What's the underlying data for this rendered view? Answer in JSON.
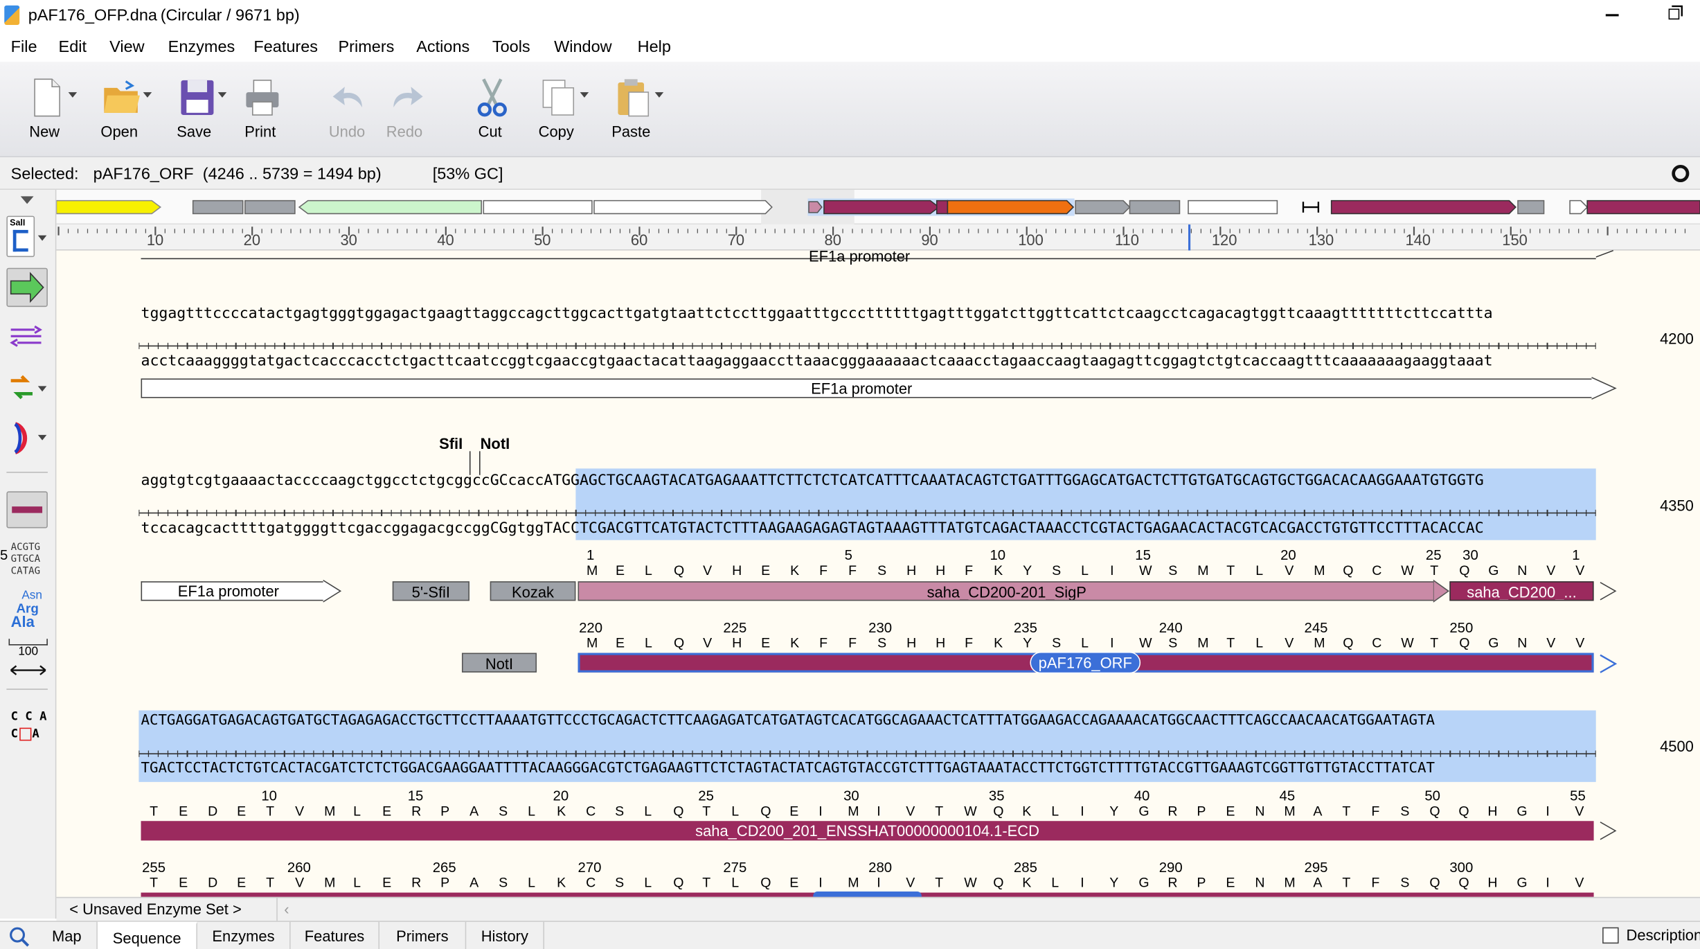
{
  "app": {
    "title": "pAF176_OFP.dna",
    "title_detail": "(Circular / 9671 bp)"
  },
  "menu": [
    "File",
    "Edit",
    "View",
    "Enzymes",
    "Features",
    "Primers",
    "Actions",
    "Tools",
    "Window",
    "Help"
  ],
  "toolbar": {
    "new": "New",
    "open": "Open",
    "save": "Save",
    "print": "Print",
    "undo": "Undo",
    "redo": "Redo",
    "cut": "Cut",
    "copy": "Copy",
    "paste": "Paste"
  },
  "selection": {
    "label": "Selected:",
    "name": "pAF176_ORF",
    "range": "(4246 .. 5739 = 1494 bp)",
    "gc": "[53% GC]"
  },
  "sidebar": {
    "sall": "SalI",
    "acgtg": "ACGTG",
    "gtgca": "GTGCA",
    "catag": "CATAG",
    "asn": "Asn",
    "arg": "Arg",
    "ala": "Ala",
    "hundred": "100",
    "cca1": "C C A",
    "cca2": "C",
    "cca3": "A"
  },
  "ruler": {
    "ticks": [
      "10",
      "20",
      "30",
      "40",
      "50",
      "60",
      "70",
      "80",
      "90",
      "100",
      "110",
      "120",
      "130",
      "140",
      "150"
    ]
  },
  "blocks": {
    "b0": {
      "feature": "EF1a promoter"
    },
    "b1": {
      "top": "tggagtttccccatactgagtgggtggagactgaagttaggccagcttggcacttgatgtaattctccttggaatttgcccttttttgagtttggatcttggttcattctcaagcctcagacagtggttcaaagtttttttcttccattta",
      "bottom": "acctcaaaggggtatgactcacccacctctgacttcaatccggtcgaaccgtgaactacattaagaggaaccttaaacgggaaaaaactcaaacctagaaccaagtaagagttcggagtctgtcaccaagtttcaaaaaaagaaggtaaat",
      "position": "4200",
      "feature": "EF1a promoter"
    },
    "b2": {
      "sites": [
        "SfiI",
        "NotI"
      ],
      "top_lower": "aggtgtcgtgaaaactaccccaagctggcctctgcggccGCcacc",
      "top_upper": "ATGGAGCTGCAAGTACATGAGAAATTCTTCTCTCATCATTTCAAATACAGTCTGATTTGGAGCATGACTCTTGTGATGCAGTGCTGGACACAAGGAAATGTGGTG",
      "bottom_lower": "tccacagcacttttgatggggttcgaccggagacgccggCGgtgg",
      "bottom_upper": "TACCTCGACGTTCATGTACTCTTTAAGAAGAGAGTAGTAAAGTTTATGTCAGACTAAACCTCGTACTGAGAACACTACGTCACGACCTGTGTTCCTTTACACCAC",
      "position": "4350",
      "aa1": [
        "M",
        "E",
        "L",
        "Q",
        "V",
        "H",
        "E",
        "K",
        "F",
        "F",
        "S",
        "H",
        "H",
        "F",
        "K",
        "Y",
        "S",
        "L",
        "I",
        "W",
        "S",
        "M",
        "T",
        "L",
        "V",
        "M",
        "Q",
        "C",
        "W",
        "T",
        "Q",
        "G",
        "N",
        "V",
        "V"
      ],
      "nums1": [
        "1",
        "5",
        "10",
        "15",
        "20",
        "25",
        "30",
        "1",
        "5"
      ],
      "feat_ef1a": "EF1a promoter",
      "feat_sfi": "5'-SfiI",
      "feat_kozak": "Kozak",
      "feat_sigp": "saha_CD200-201_SigP",
      "feat_cd200": "saha_CD200_...",
      "nums2": [
        "220",
        "225",
        "230",
        "235",
        "240",
        "245",
        "250"
      ],
      "feat_noti": "NotI",
      "feat_orf": "pAF176_ORF"
    },
    "b3": {
      "top": "ACTGAGGATGAGACAGTGATGCTAGAGAGACCTGCTTCCTTAAAATGTTCCCTGCAGACTCTTCAAGAGATCATGATAGTCACATGGCAGAAACTCATTTATGGAAGACCAGAAAACATGGCAACTTTCAGCCAACAACATGGAATAGTA",
      "bottom": "TGACTCCTACTCTGTCACTACGATCTCTCTGGACGAAGGAATTTTACAAGGGACGTCTGAGAAGTTCTCTAGTACTATCAGTGTACCGTCTTTGAGTAAATACCTTCTGGTCTTTTGTACCGTTGAAAGTCGGTTGTTGTACCTTATCAT",
      "position": "4500",
      "aa": [
        "T",
        "E",
        "D",
        "E",
        "T",
        "V",
        "M",
        "L",
        "E",
        "R",
        "P",
        "A",
        "S",
        "L",
        "K",
        "C",
        "S",
        "L",
        "Q",
        "T",
        "L",
        "Q",
        "E",
        "I",
        "M",
        "I",
        "V",
        "T",
        "W",
        "Q",
        "K",
        "L",
        "I",
        "Y",
        "G",
        "R",
        "P",
        "E",
        "N",
        "M",
        "A",
        "T",
        "F",
        "S",
        "Q",
        "Q",
        "H",
        "G",
        "I",
        "V"
      ],
      "nums1": [
        "10",
        "15",
        "20",
        "25",
        "30",
        "35",
        "40",
        "45",
        "50",
        "55"
      ],
      "feat_ecd": "saha_CD200_201_ENSSHAT00000000104.1-ECD",
      "nums2": [
        "255",
        "260",
        "265",
        "270",
        "275",
        "280",
        "285",
        "290",
        "295",
        "300"
      ]
    }
  },
  "enzymeset": "< Unsaved Enzyme Set >",
  "tabs": [
    "Map",
    "Sequence",
    "Enzymes",
    "Features",
    "Primers",
    "History"
  ],
  "description": "Description",
  "colors": {
    "selection": "#b8d4f8",
    "orf": "#9b2a5e",
    "sigp": "#c98aa6",
    "gray_feature": "#9ea2a8"
  }
}
